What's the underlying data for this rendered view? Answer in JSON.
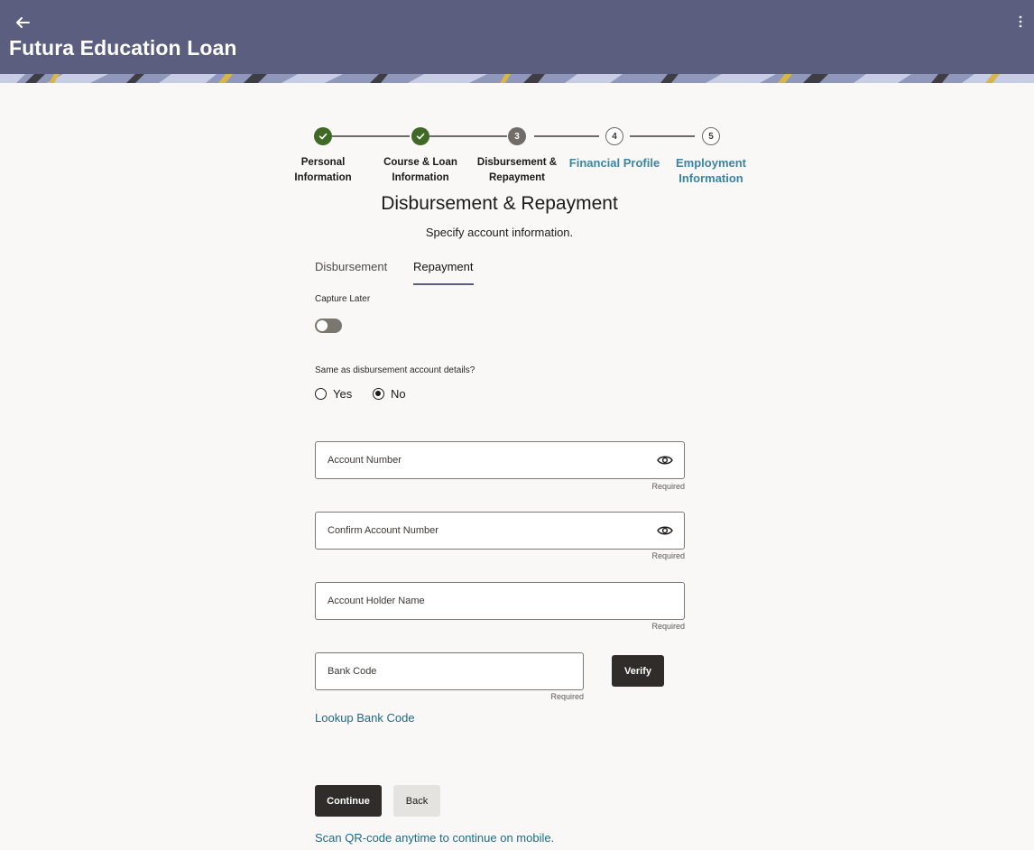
{
  "header": {
    "title": "Futura Education Loan",
    "back_icon": "arrow-left-icon",
    "menu_icon": "kebab-menu-icon"
  },
  "stepper": {
    "steps": [
      {
        "label": "Personal\nInformation",
        "status": "done"
      },
      {
        "label": "Course & Loan\nInformation",
        "status": "done"
      },
      {
        "number": "3",
        "label": "Disbursement &\nRepayment",
        "status": "current"
      },
      {
        "number": "4",
        "label": "Financial Profile",
        "status": "pending"
      },
      {
        "number": "5",
        "label": "Employment\nInformation",
        "status": "pending"
      }
    ]
  },
  "page": {
    "title": "Disbursement & Repayment",
    "subtitle": "Specify account information."
  },
  "tabs": {
    "disbursement": "Disbursement",
    "repayment": "Repayment",
    "active": "repayment"
  },
  "form": {
    "capture_later_label": "Capture Later",
    "capture_later_on": false,
    "same_as_label": "Same as disbursement account details?",
    "yes_label": "Yes",
    "no_label": "No",
    "selected": "No",
    "account_number_placeholder": "Account Number",
    "confirm_account_number_placeholder": "Confirm Account Number",
    "account_holder_name_placeholder": "Account Holder Name",
    "bank_code_placeholder": "Bank Code",
    "required_text": "Required",
    "verify_label": "Verify",
    "lookup_link": "Lookup Bank Code"
  },
  "actions": {
    "continue_label": "Continue",
    "back_label": "Back",
    "qr_link": "Scan QR-code anytime to continue on mobile."
  },
  "colors": {
    "header_bg": "#5b5e7e",
    "step_done": "#3f6a25",
    "step_current": "#716c67",
    "link": "#1e6a8a",
    "step_link": "#3b84a6",
    "dark_button": "#2f2c29"
  }
}
